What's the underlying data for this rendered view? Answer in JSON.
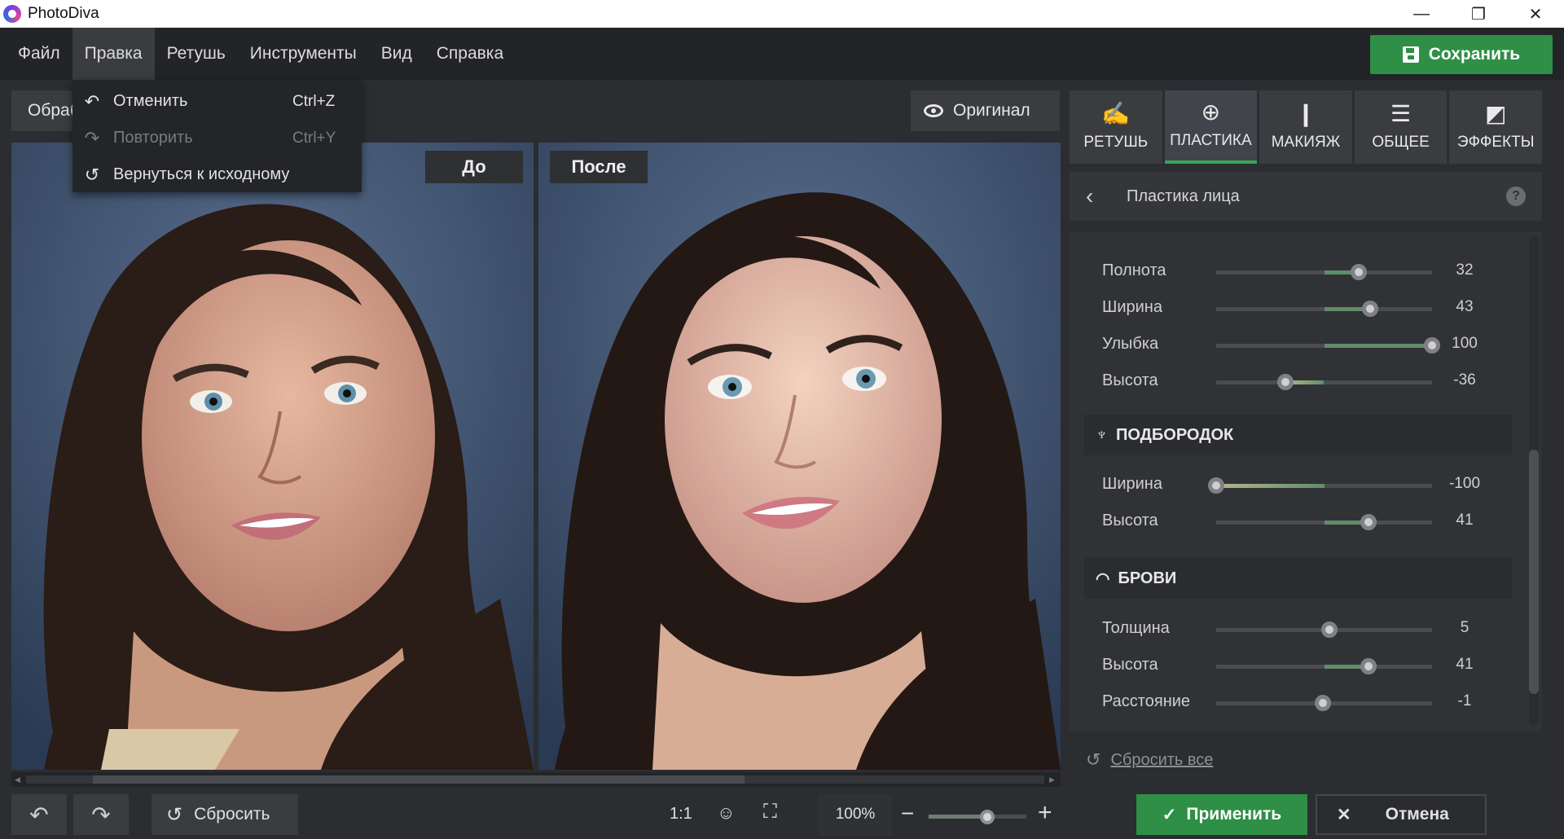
{
  "app": {
    "title": "PhotoDiva"
  },
  "window": {
    "minimize": "—",
    "restore": "❐",
    "close": "✕"
  },
  "menu": [
    "Файл",
    "Правка",
    "Ретушь",
    "Инструменты",
    "Вид",
    "Справка"
  ],
  "save_label": "Сохранить",
  "dropdown": [
    {
      "label": "Отменить",
      "shortcut": "Ctrl+Z",
      "icon": "undo-icon",
      "disabled": false
    },
    {
      "label": "Повторить",
      "shortcut": "Ctrl+Y",
      "icon": "redo-icon",
      "disabled": true
    },
    {
      "label": "Вернуться к исходному",
      "shortcut": "",
      "icon": "revert-icon",
      "disabled": false
    }
  ],
  "toolbar": {
    "process_label": "Обраб",
    "original_label": "Оригинал"
  },
  "canvas": {
    "before_label": "До",
    "after_label": "После"
  },
  "tabs": [
    {
      "label": "РЕТУШЬ",
      "icon": "retouch-icon"
    },
    {
      "label": "ПЛАСТИКА",
      "icon": "plastic-icon",
      "active": true
    },
    {
      "label": "МАКИЯЖ",
      "icon": "makeup-icon"
    },
    {
      "label": "ОБЩЕЕ",
      "icon": "sliders-icon"
    },
    {
      "label": "ЭФФЕКТЫ",
      "icon": "effects-icon"
    }
  ],
  "panel": {
    "title": "Пластика лица",
    "help": "?",
    "sliders_top": [
      {
        "label": "Полнота",
        "value": 32
      },
      {
        "label": "Ширина",
        "value": 43
      },
      {
        "label": "Улыбка",
        "value": 100
      },
      {
        "label": "Высота",
        "value": -36
      }
    ],
    "chin": {
      "title": "ПОДБОРОДОК",
      "sliders": [
        {
          "label": "Ширина",
          "value": -100
        },
        {
          "label": "Высота",
          "value": 41
        }
      ]
    },
    "brows": {
      "title": "БРОВИ",
      "sliders": [
        {
          "label": "Толщина",
          "value": 5
        },
        {
          "label": "Высота",
          "value": 41
        },
        {
          "label": "Расстояние",
          "value": -1
        }
      ]
    },
    "reset_all": "Сбросить все"
  },
  "bottom": {
    "reset_label": "Сбросить",
    "ratio_label": "1:1",
    "zoom_label": "100%",
    "zoom_level": 0.6,
    "apply_label": "Применить",
    "cancel_label": "Отмена"
  },
  "colors": {
    "accent": "#2f8f46",
    "panel": "#303236",
    "slider_fill": "#5f8d6a"
  }
}
